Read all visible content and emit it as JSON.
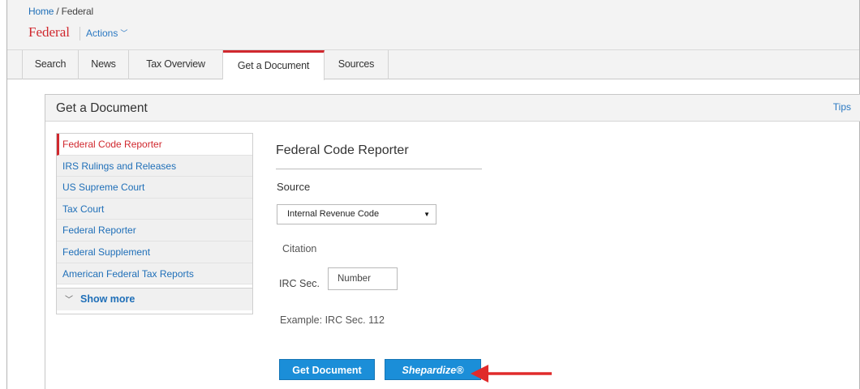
{
  "breadcrumb": {
    "home": "Home",
    "separator": " / ",
    "current": "Federal"
  },
  "header": {
    "title": "Federal",
    "actions_label": "Actions"
  },
  "tabs": [
    {
      "label": "Search"
    },
    {
      "label": "News"
    },
    {
      "label": "Tax Overview"
    },
    {
      "label": "Get a Document",
      "active": true
    },
    {
      "label": "Sources"
    }
  ],
  "panel": {
    "title": "Get a Document",
    "tips": "Tips"
  },
  "sidebar": {
    "items": [
      {
        "label": "Federal Code Reporter",
        "active": true
      },
      {
        "label": "IRS Rulings and Releases"
      },
      {
        "label": "US Supreme Court"
      },
      {
        "label": "Tax Court"
      },
      {
        "label": "Federal Reporter"
      },
      {
        "label": "Federal Supplement"
      },
      {
        "label": "American Federal Tax Reports"
      }
    ],
    "show_more": "Show more"
  },
  "form": {
    "title": "Federal Code Reporter",
    "source_label": "Source",
    "source_value": "Internal Revenue Code",
    "citation_label": "Citation",
    "irc_label": "IRC Sec.",
    "number_placeholder": "Number",
    "example": "Example: IRC Sec. 112",
    "get_document": "Get Document",
    "shepardize": "Shepardize®"
  },
  "colors": {
    "brand_red": "#d0282e",
    "link_blue": "#1f6fb8",
    "button_blue": "#1b8ed8",
    "annotation_arrow": "#e02b2b"
  },
  "icons": {
    "actions": "chevron-down-icon",
    "select": "caret-down-icon",
    "show_more": "chevron-down-icon",
    "annotation": "arrow-left-icon"
  }
}
